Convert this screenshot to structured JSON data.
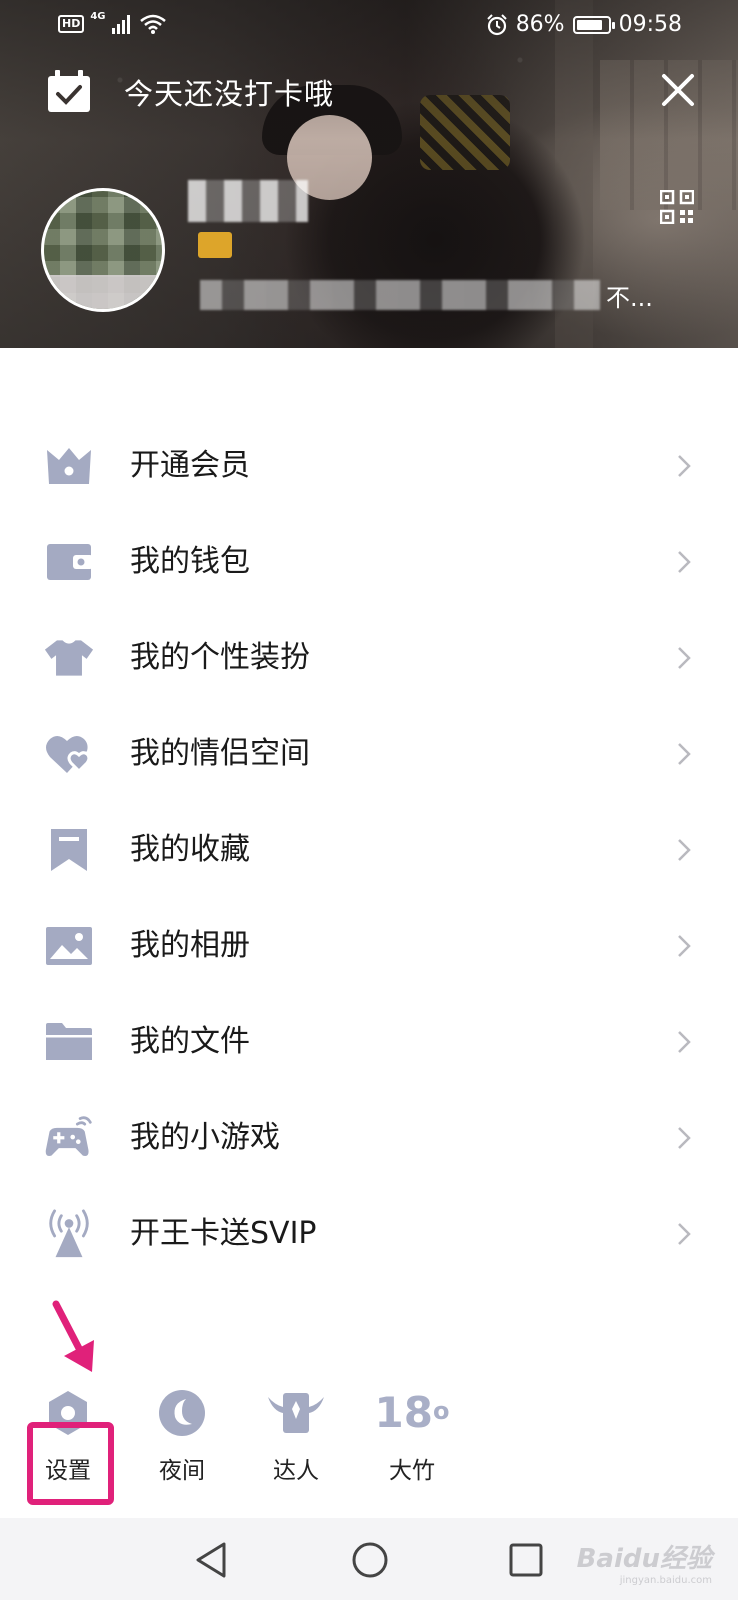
{
  "status_bar": {
    "hd_label": "HD",
    "network_label": "4G",
    "battery_percent": "86%",
    "battery_level": 0.86,
    "time": "09:58"
  },
  "header": {
    "checkin_text": "今天还没打卡哦",
    "signature_tail": "不..."
  },
  "menu": {
    "items": [
      {
        "label": "开通会员",
        "icon": "crown-icon"
      },
      {
        "label": "我的钱包",
        "icon": "wallet-icon"
      },
      {
        "label": "我的个性装扮",
        "icon": "shirt-icon"
      },
      {
        "label": "我的情侣空间",
        "icon": "hearts-icon"
      },
      {
        "label": "我的收藏",
        "icon": "bookmark-icon"
      },
      {
        "label": "我的相册",
        "icon": "photo-icon"
      },
      {
        "label": "我的文件",
        "icon": "folder-icon"
      },
      {
        "label": "我的小游戏",
        "icon": "gamepad-icon"
      },
      {
        "label": "开王卡送SVIP",
        "icon": "broadcast-icon"
      }
    ]
  },
  "shortcuts": {
    "settings_label": "设置",
    "night_label": "夜间",
    "expert_label": "达人",
    "weather_temp": "18",
    "weather_unit": "o",
    "weather_city": "大竹"
  },
  "colors": {
    "icon": "#a4aac2",
    "highlight": "#e0217a"
  },
  "watermark": {
    "main": "Baidu经验",
    "sub": "jingyan.baidu.com"
  }
}
